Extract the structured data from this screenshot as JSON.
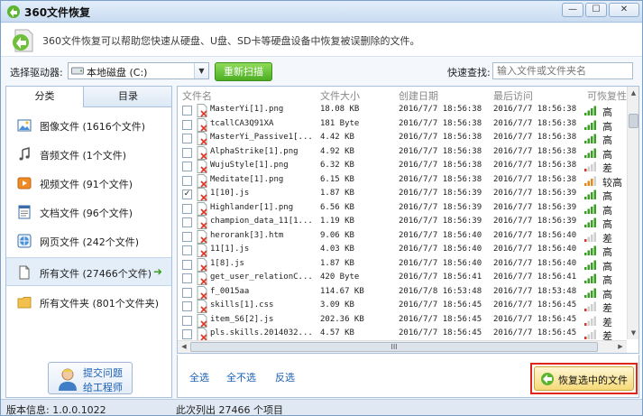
{
  "window": {
    "title": "360文件恢复",
    "min_label": "—",
    "max_label": "☐",
    "close_label": "✕"
  },
  "banner": {
    "text": "360文件恢复可以帮助您快速从硬盘、U盘、SD卡等硬盘设备中恢复被误删除的文件。"
  },
  "drive": {
    "label": "选择驱动器:",
    "value": "本地磁盘 (C:)",
    "scan_button": "重新扫描"
  },
  "search": {
    "label": "快速查找:",
    "placeholder": "输入文件或文件夹名"
  },
  "tabs": {
    "category": "分类",
    "directory": "目录"
  },
  "categories": [
    {
      "label": "图像文件 (1616个文件)",
      "icon": "image-icon"
    },
    {
      "label": "音频文件 (1个文件)",
      "icon": "music-icon"
    },
    {
      "label": "视频文件 (91个文件)",
      "icon": "video-icon"
    },
    {
      "label": "文档文件 (96个文件)",
      "icon": "document-icon"
    },
    {
      "label": "网页文件 (242个文件)",
      "icon": "webpage-icon"
    },
    {
      "label": "所有文件 (27466个文件)",
      "icon": "file-icon",
      "arrow": "➜"
    },
    {
      "label": "所有文件夹 (801个文件夹)",
      "icon": "folder-icon"
    }
  ],
  "feedback": {
    "line1": "提交问题",
    "line2": "给工程师"
  },
  "columns": {
    "name": "文件名",
    "size": "文件大小",
    "created": "创建日期",
    "accessed": "最后访问",
    "recoverability": "可恢复性"
  },
  "files": [
    {
      "name": "MasterYi[1].png",
      "size": "18.08 KB",
      "created": "2016/7/7 18:56:38",
      "accessed": "2016/7/7 18:56:38",
      "level": "高",
      "bars": 4,
      "checked": false
    },
    {
      "name": "tcallCA3Q91XA",
      "size": "181 Byte",
      "created": "2016/7/7 18:56:38",
      "accessed": "2016/7/7 18:56:38",
      "level": "高",
      "bars": 4,
      "checked": false
    },
    {
      "name": "MasterYi_Passive1[...",
      "size": "4.42 KB",
      "created": "2016/7/7 18:56:38",
      "accessed": "2016/7/7 18:56:38",
      "level": "高",
      "bars": 4,
      "checked": false
    },
    {
      "name": "AlphaStrike[1].png",
      "size": "4.92 KB",
      "created": "2016/7/7 18:56:38",
      "accessed": "2016/7/7 18:56:38",
      "level": "高",
      "bars": 4,
      "checked": false
    },
    {
      "name": "WujuStyle[1].png",
      "size": "6.32 KB",
      "created": "2016/7/7 18:56:38",
      "accessed": "2016/7/7 18:56:38",
      "level": "差",
      "bars": 1,
      "checked": false
    },
    {
      "name": "Meditate[1].png",
      "size": "6.15 KB",
      "created": "2016/7/7 18:56:38",
      "accessed": "2016/7/7 18:56:38",
      "level": "较高",
      "bars": 3,
      "checked": false
    },
    {
      "name": "1[10].js",
      "size": "1.87 KB",
      "created": "2016/7/7 18:56:39",
      "accessed": "2016/7/7 18:56:39",
      "level": "高",
      "bars": 4,
      "checked": true
    },
    {
      "name": "Highlander[1].png",
      "size": "6.56 KB",
      "created": "2016/7/7 18:56:39",
      "accessed": "2016/7/7 18:56:39",
      "level": "高",
      "bars": 4,
      "checked": false
    },
    {
      "name": "champion_data_11[1...",
      "size": "1.19 KB",
      "created": "2016/7/7 18:56:39",
      "accessed": "2016/7/7 18:56:39",
      "level": "高",
      "bars": 4,
      "checked": false
    },
    {
      "name": "herorank[3].htm",
      "size": "9.06 KB",
      "created": "2016/7/7 18:56:40",
      "accessed": "2016/7/7 18:56:40",
      "level": "差",
      "bars": 1,
      "checked": false
    },
    {
      "name": "11[1].js",
      "size": "4.03 KB",
      "created": "2016/7/7 18:56:40",
      "accessed": "2016/7/7 18:56:40",
      "level": "高",
      "bars": 4,
      "checked": false
    },
    {
      "name": "1[8].js",
      "size": "1.87 KB",
      "created": "2016/7/7 18:56:40",
      "accessed": "2016/7/7 18:56:40",
      "level": "高",
      "bars": 4,
      "checked": false
    },
    {
      "name": "get_user_relationC...",
      "size": "420 Byte",
      "created": "2016/7/7 18:56:41",
      "accessed": "2016/7/7 18:56:41",
      "level": "高",
      "bars": 4,
      "checked": false
    },
    {
      "name": "f_0015aa",
      "size": "114.67 KB",
      "created": "2016/7/8 16:53:48",
      "accessed": "2016/7/7 18:53:48",
      "level": "高",
      "bars": 4,
      "checked": false
    },
    {
      "name": "skills[1].css",
      "size": "3.09 KB",
      "created": "2016/7/7 18:56:45",
      "accessed": "2016/7/7 18:56:45",
      "level": "差",
      "bars": 1,
      "checked": false
    },
    {
      "name": "item_S6[2].js",
      "size": "202.36 KB",
      "created": "2016/7/7 18:56:45",
      "accessed": "2016/7/7 18:56:45",
      "level": "差",
      "bars": 1,
      "checked": false
    },
    {
      "name": "pls.skills.2014032...",
      "size": "4.57 KB",
      "created": "2016/7/7 18:56:45",
      "accessed": "2016/7/7 18:56:45",
      "level": "差",
      "bars": 1,
      "checked": false
    }
  ],
  "scroll": {
    "up": "▲",
    "down": "▼",
    "left": "◀",
    "right": "▶",
    "grip": "III"
  },
  "actions": {
    "select_all": "全选",
    "select_none": "全不选",
    "invert": "反选",
    "restore": "恢复选中的文件"
  },
  "status": {
    "version": "版本信息: 1.0.0.1022",
    "listed": "此次列出 27466 个项目"
  },
  "colors": {
    "good": "#3aa023",
    "medium": "#e08a1a",
    "poor": "#d23a2a",
    "highlight": "#e0261b"
  }
}
